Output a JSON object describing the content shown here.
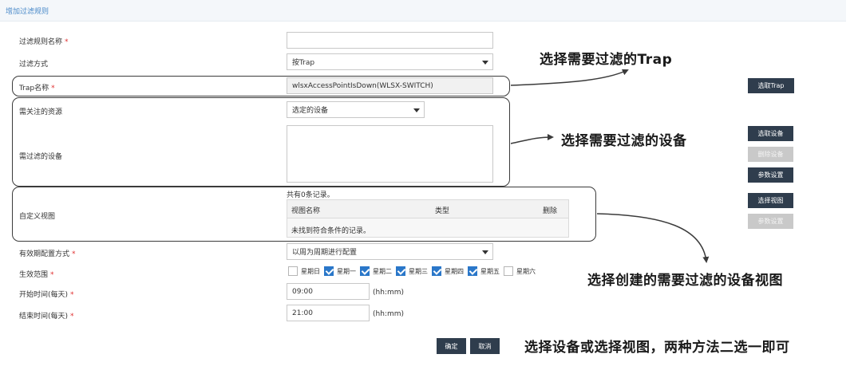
{
  "header": {
    "title": "增加过滤规则"
  },
  "form": {
    "rule_name": {
      "label": "过滤规则名称",
      "required": "*",
      "value": ""
    },
    "filter_method": {
      "label": "过滤方式",
      "value": "按Trap"
    },
    "trap_name": {
      "label": "Trap名称",
      "required": "*",
      "value": "wlsxAccessPointIsDown(WLSX-SWITCH)",
      "button": "选取Trap"
    },
    "resources": {
      "label": "需关注的资源",
      "value": "选定的设备"
    },
    "devices": {
      "label": "需过滤的设备",
      "buttons": {
        "select": "选取设备",
        "delete": "删除设备",
        "params": "参数设置"
      }
    },
    "custom_view": {
      "label": "自定义视图",
      "record_count": "共有0条记录。",
      "columns": [
        "视图名称",
        "类型",
        "删除"
      ],
      "empty_text": "未找到符合条件的记录。",
      "buttons": {
        "select": "选择视图",
        "params": "参数设置"
      }
    },
    "effective_mode": {
      "label": "有效期配置方式",
      "required": "*",
      "value": "以周为周期进行配置"
    },
    "effective_range": {
      "label": "生效范围",
      "required": "*",
      "days": [
        {
          "label": "星期日",
          "checked": false
        },
        {
          "label": "星期一",
          "checked": true
        },
        {
          "label": "星期二",
          "checked": true
        },
        {
          "label": "星期三",
          "checked": true
        },
        {
          "label": "星期四",
          "checked": true
        },
        {
          "label": "星期五",
          "checked": true
        },
        {
          "label": "星期六",
          "checked": false
        }
      ]
    },
    "start_time": {
      "label": "开始时间(每天)",
      "required": "*",
      "value": "09:00",
      "unit": "(hh:mm)"
    },
    "end_time": {
      "label": "结束时间(每天)",
      "required": "*",
      "value": "21:00",
      "unit": "(hh:mm)"
    }
  },
  "actions": {
    "ok": "确定",
    "cancel": "取消"
  },
  "annotations": {
    "trap": "选择需要过滤的Trap",
    "devices": "选择需要过滤的设备",
    "view": "选择创建的需要过滤的设备视图",
    "either": "选择设备或选择视图，两种方法二选一即可"
  },
  "colors": {
    "accent": "#2f3d4d",
    "link": "#4a8ac9",
    "required": "#e03030",
    "checkbox": "#2a77c9"
  }
}
